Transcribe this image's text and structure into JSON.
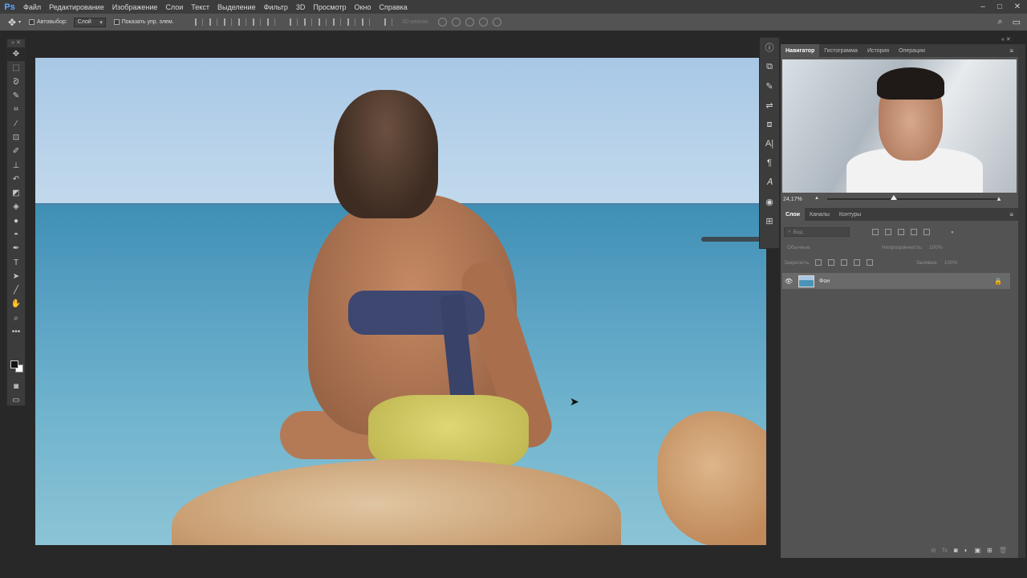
{
  "app": {
    "logo": "Ps"
  },
  "menu": {
    "items": [
      "Файл",
      "Редактирование",
      "Изображение",
      "Слои",
      "Текст",
      "Выделение",
      "Фильтр",
      "3D",
      "Просмотр",
      "Окно",
      "Справка"
    ]
  },
  "window_controls": {
    "minimize": "–",
    "maximize": "□",
    "close": "✕"
  },
  "options_bar": {
    "tool_icon": "move-icon",
    "auto_select_label": "Автовыбор:",
    "auto_select_value": "Слой",
    "show_transform_label": "Показать упр. элем.",
    "mode_3d_label": "3D-режим:"
  },
  "toolbar": {
    "tools": [
      "move-tool",
      "marquee-tool",
      "lasso-tool",
      "quick-select-tool",
      "crop-tool",
      "eyedropper-tool",
      "frame-tool",
      "brush-tool",
      "stamp-tool",
      "history-brush-tool",
      "eraser-tool",
      "bucket-tool",
      "blur-tool",
      "dodge-tool",
      "pen-tool",
      "type-tool",
      "path-select-tool",
      "line-tool",
      "hand-tool",
      "zoom-tool",
      "more-tools"
    ]
  },
  "navigator": {
    "tabs": [
      "Навигатор",
      "Гистограмма",
      "История",
      "Операции"
    ],
    "active_tab": "Навигатор",
    "zoom": "24,17%"
  },
  "layers_panel": {
    "tabs": [
      "Слои",
      "Каналы",
      "Контуры"
    ],
    "active_tab": "Слои",
    "filter_placeholder": "Вид",
    "blend_mode": "Обычные",
    "opacity_label": "Непрозрачность:",
    "opacity_value": "100%",
    "lock_label": "Закрепить:",
    "fill_label": "Заливка:",
    "fill_value": "100%",
    "layers": [
      {
        "name": "Фон",
        "visible": true,
        "locked": true
      }
    ]
  },
  "colors": {
    "accent": "#5fa8ff",
    "panel_bg": "#535353",
    "dark_bg": "#282828"
  }
}
